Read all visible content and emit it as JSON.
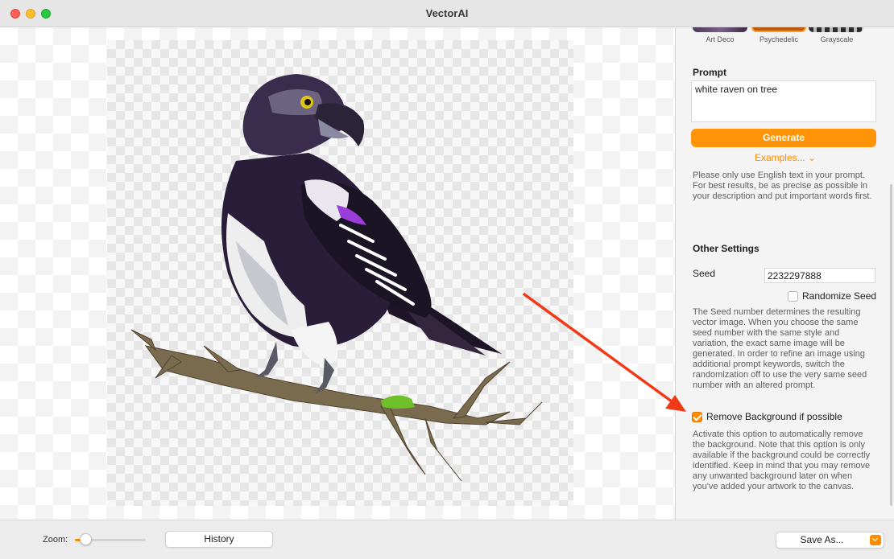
{
  "window": {
    "title": "VectorAI"
  },
  "styles": [
    {
      "label": "Art Deco"
    },
    {
      "label": "Psychedelic"
    },
    {
      "label": "Grayscale"
    }
  ],
  "prompt": {
    "title": "Prompt",
    "value": "white raven on tree",
    "generate_label": "Generate",
    "examples_label": "Examples... ⌄",
    "help": "Please only use English text in your prompt. For best results, be as precise as possible in your description and put important words first."
  },
  "other_settings": {
    "title": "Other Settings",
    "seed_label": "Seed",
    "seed_value": "2232297888",
    "randomize_label": "Randomize Seed",
    "randomize_checked": false,
    "seed_help": "The Seed number determines the resulting vector image. When you choose the same seed number with the same style and variation, the exact same image will be generated. In order to refine an image using additional prompt keywords, switch the randomization off to use the very same seed number with an altered prompt.",
    "remove_bg_label": "Remove Background if possible",
    "remove_bg_checked": true,
    "remove_bg_help": "Activate this option to automatically remove the background. Note that this option is only available if the background could be correctly identified. Keep in mind that you may remove any unwanted background later on when you've added your artwork to the canvas."
  },
  "bottom": {
    "zoom_label": "Zoom:",
    "zoom_level": 0.15,
    "history_label": "History",
    "save_as_label": "Save As..."
  },
  "colors": {
    "accent": "#ff8c00",
    "annotation_arrow": "#f03a17"
  }
}
